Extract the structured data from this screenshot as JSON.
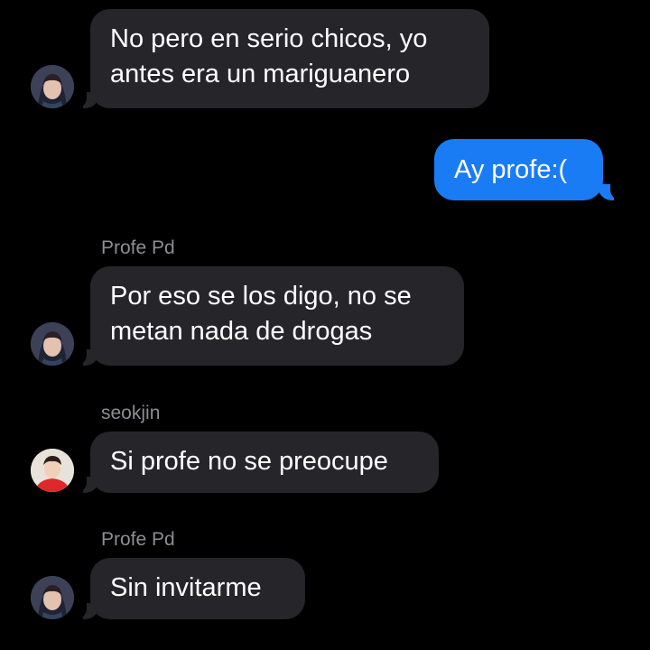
{
  "messages": [
    {
      "sender": "",
      "lines": [
        "No pero en serio chicos, yo",
        "antes era un mariguanero"
      ],
      "direction": "incoming"
    },
    {
      "sender": "",
      "lines": [
        "Ay profe:("
      ],
      "direction": "outgoing"
    },
    {
      "sender": "Profe Pd",
      "lines": [
        "Por eso se los digo, no se",
        "metan nada de drogas"
      ],
      "direction": "incoming"
    },
    {
      "sender": "seokjin",
      "lines": [
        "Si profe no se preocupe"
      ],
      "direction": "incoming"
    },
    {
      "sender": "Profe Pd",
      "lines": [
        "Sin invitarme"
      ],
      "direction": "incoming"
    }
  ],
  "colors": {
    "background": "#000000",
    "incoming_bubble": "#26252a",
    "outgoing_bubble": "#1a7cf5",
    "sender_name": "#8d8d93"
  }
}
